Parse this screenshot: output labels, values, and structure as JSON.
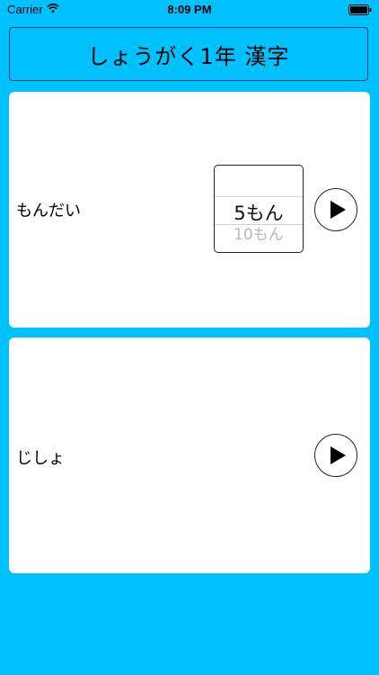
{
  "status_bar": {
    "carrier": "Carrier",
    "time": "8:09 PM",
    "wifi_icon": "wifi-icon",
    "battery_icon": "battery-icon"
  },
  "title": "しょうがく1年 漢字",
  "problem_card": {
    "label": "もんだい",
    "picker": {
      "selected": "5もん",
      "next": "10もん"
    },
    "play_icon": "play-icon"
  },
  "dict_card": {
    "label": "じしょ",
    "play_icon": "play-icon"
  },
  "colors": {
    "background": "#00c1ff",
    "card": "#ffffff",
    "border": "#1c3d66"
  }
}
